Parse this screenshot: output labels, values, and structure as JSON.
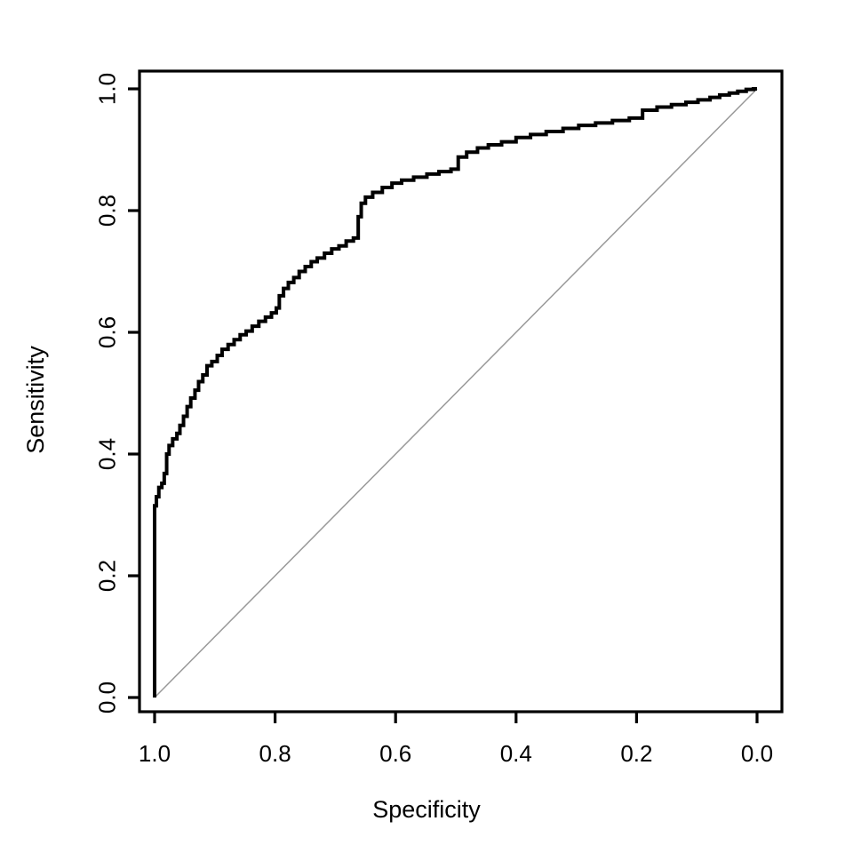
{
  "chart_data": {
    "type": "line",
    "title": "",
    "subtitle": "",
    "xlabel": "Specificity",
    "ylabel": "Sensitivity",
    "xlim": [
      1.0,
      0.0
    ],
    "ylim": [
      0.0,
      1.0
    ],
    "x_reversed": true,
    "grid": false,
    "legend": "none",
    "annotations": [],
    "x_ticks": [
      "1.0",
      "0.8",
      "0.6",
      "0.4",
      "0.2",
      "0.0"
    ],
    "x_tick_values": [
      1.0,
      0.8,
      0.6,
      0.4,
      0.2,
      0.0
    ],
    "y_ticks": [
      "0.0",
      "0.2",
      "0.4",
      "0.6",
      "0.8",
      "1.0"
    ],
    "y_tick_values": [
      0.0,
      0.2,
      0.4,
      0.6,
      0.8,
      1.0
    ],
    "series": [
      {
        "name": "ROC curve",
        "color": "#000000",
        "line_width": 4,
        "style": "step",
        "x_name": "specificity",
        "y_name": "sensitivity",
        "points": [
          [
            1.0,
            0.0
          ],
          [
            1.0,
            0.315
          ],
          [
            0.997,
            0.315
          ],
          [
            0.997,
            0.33
          ],
          [
            0.993,
            0.33
          ],
          [
            0.993,
            0.345
          ],
          [
            0.988,
            0.345
          ],
          [
            0.988,
            0.352
          ],
          [
            0.984,
            0.352
          ],
          [
            0.984,
            0.368
          ],
          [
            0.98,
            0.368
          ],
          [
            0.98,
            0.4
          ],
          [
            0.976,
            0.4
          ],
          [
            0.976,
            0.414
          ],
          [
            0.97,
            0.414
          ],
          [
            0.97,
            0.425
          ],
          [
            0.963,
            0.425
          ],
          [
            0.963,
            0.434
          ],
          [
            0.958,
            0.434
          ],
          [
            0.958,
            0.447
          ],
          [
            0.952,
            0.447
          ],
          [
            0.952,
            0.462
          ],
          [
            0.946,
            0.462
          ],
          [
            0.946,
            0.478
          ],
          [
            0.94,
            0.478
          ],
          [
            0.94,
            0.492
          ],
          [
            0.933,
            0.492
          ],
          [
            0.933,
            0.505
          ],
          [
            0.927,
            0.505
          ],
          [
            0.927,
            0.519
          ],
          [
            0.92,
            0.519
          ],
          [
            0.92,
            0.53
          ],
          [
            0.913,
            0.53
          ],
          [
            0.913,
            0.545
          ],
          [
            0.905,
            0.545
          ],
          [
            0.905,
            0.552
          ],
          [
            0.896,
            0.552
          ],
          [
            0.896,
            0.562
          ],
          [
            0.888,
            0.562
          ],
          [
            0.888,
            0.572
          ],
          [
            0.878,
            0.572
          ],
          [
            0.878,
            0.58
          ],
          [
            0.868,
            0.58
          ],
          [
            0.868,
            0.588
          ],
          [
            0.858,
            0.588
          ],
          [
            0.858,
            0.596
          ],
          [
            0.848,
            0.596
          ],
          [
            0.848,
            0.602
          ],
          [
            0.838,
            0.602
          ],
          [
            0.838,
            0.61
          ],
          [
            0.827,
            0.61
          ],
          [
            0.827,
            0.618
          ],
          [
            0.816,
            0.618
          ],
          [
            0.816,
            0.625
          ],
          [
            0.806,
            0.625
          ],
          [
            0.806,
            0.632
          ],
          [
            0.798,
            0.632
          ],
          [
            0.798,
            0.64
          ],
          [
            0.793,
            0.64
          ],
          [
            0.793,
            0.66
          ],
          [
            0.786,
            0.66
          ],
          [
            0.786,
            0.672
          ],
          [
            0.778,
            0.672
          ],
          [
            0.778,
            0.682
          ],
          [
            0.769,
            0.682
          ],
          [
            0.769,
            0.69
          ],
          [
            0.76,
            0.69
          ],
          [
            0.76,
            0.7
          ],
          [
            0.75,
            0.7
          ],
          [
            0.75,
            0.708
          ],
          [
            0.74,
            0.708
          ],
          [
            0.74,
            0.716
          ],
          [
            0.73,
            0.716
          ],
          [
            0.73,
            0.722
          ],
          [
            0.718,
            0.722
          ],
          [
            0.718,
            0.73
          ],
          [
            0.706,
            0.73
          ],
          [
            0.706,
            0.737
          ],
          [
            0.694,
            0.737
          ],
          [
            0.694,
            0.742
          ],
          [
            0.682,
            0.742
          ],
          [
            0.682,
            0.75
          ],
          [
            0.67,
            0.75
          ],
          [
            0.67,
            0.755
          ],
          [
            0.662,
            0.755
          ],
          [
            0.662,
            0.79
          ],
          [
            0.657,
            0.79
          ],
          [
            0.657,
            0.812
          ],
          [
            0.65,
            0.812
          ],
          [
            0.65,
            0.822
          ],
          [
            0.638,
            0.822
          ],
          [
            0.638,
            0.83
          ],
          [
            0.622,
            0.83
          ],
          [
            0.622,
            0.838
          ],
          [
            0.606,
            0.838
          ],
          [
            0.606,
            0.845
          ],
          [
            0.59,
            0.845
          ],
          [
            0.59,
            0.85
          ],
          [
            0.57,
            0.85
          ],
          [
            0.57,
            0.855
          ],
          [
            0.548,
            0.855
          ],
          [
            0.548,
            0.86
          ],
          [
            0.528,
            0.86
          ],
          [
            0.528,
            0.864
          ],
          [
            0.508,
            0.864
          ],
          [
            0.508,
            0.868
          ],
          [
            0.496,
            0.868
          ],
          [
            0.496,
            0.888
          ],
          [
            0.482,
            0.888
          ],
          [
            0.482,
            0.896
          ],
          [
            0.464,
            0.896
          ],
          [
            0.464,
            0.903
          ],
          [
            0.446,
            0.903
          ],
          [
            0.446,
            0.908
          ],
          [
            0.424,
            0.908
          ],
          [
            0.424,
            0.913
          ],
          [
            0.4,
            0.913
          ],
          [
            0.4,
            0.92
          ],
          [
            0.376,
            0.92
          ],
          [
            0.376,
            0.925
          ],
          [
            0.35,
            0.925
          ],
          [
            0.35,
            0.93
          ],
          [
            0.322,
            0.93
          ],
          [
            0.322,
            0.935
          ],
          [
            0.296,
            0.935
          ],
          [
            0.296,
            0.94
          ],
          [
            0.268,
            0.94
          ],
          [
            0.268,
            0.944
          ],
          [
            0.24,
            0.944
          ],
          [
            0.24,
            0.948
          ],
          [
            0.212,
            0.948
          ],
          [
            0.212,
            0.952
          ],
          [
            0.19,
            0.952
          ],
          [
            0.19,
            0.965
          ],
          [
            0.166,
            0.965
          ],
          [
            0.166,
            0.97
          ],
          [
            0.142,
            0.97
          ],
          [
            0.142,
            0.974
          ],
          [
            0.118,
            0.974
          ],
          [
            0.118,
            0.978
          ],
          [
            0.098,
            0.978
          ],
          [
            0.098,
            0.982
          ],
          [
            0.078,
            0.982
          ],
          [
            0.078,
            0.986
          ],
          [
            0.062,
            0.986
          ],
          [
            0.062,
            0.99
          ],
          [
            0.046,
            0.99
          ],
          [
            0.046,
            0.993
          ],
          [
            0.032,
            0.993
          ],
          [
            0.032,
            0.996
          ],
          [
            0.018,
            0.996
          ],
          [
            0.018,
            0.999
          ],
          [
            0.006,
            0.999
          ],
          [
            0.006,
            1.0
          ],
          [
            0.0,
            1.0
          ]
        ]
      },
      {
        "name": "chance line",
        "color": "#999999",
        "line_width": 1.5,
        "style": "straight",
        "points": [
          [
            1.0,
            0.0
          ],
          [
            0.0,
            1.0
          ]
        ]
      }
    ]
  },
  "plot": {
    "background_color": "#ffffff",
    "frame_color": "#000000",
    "axis_title_x": "Specificity",
    "axis_title_y": "Sensitivity"
  }
}
